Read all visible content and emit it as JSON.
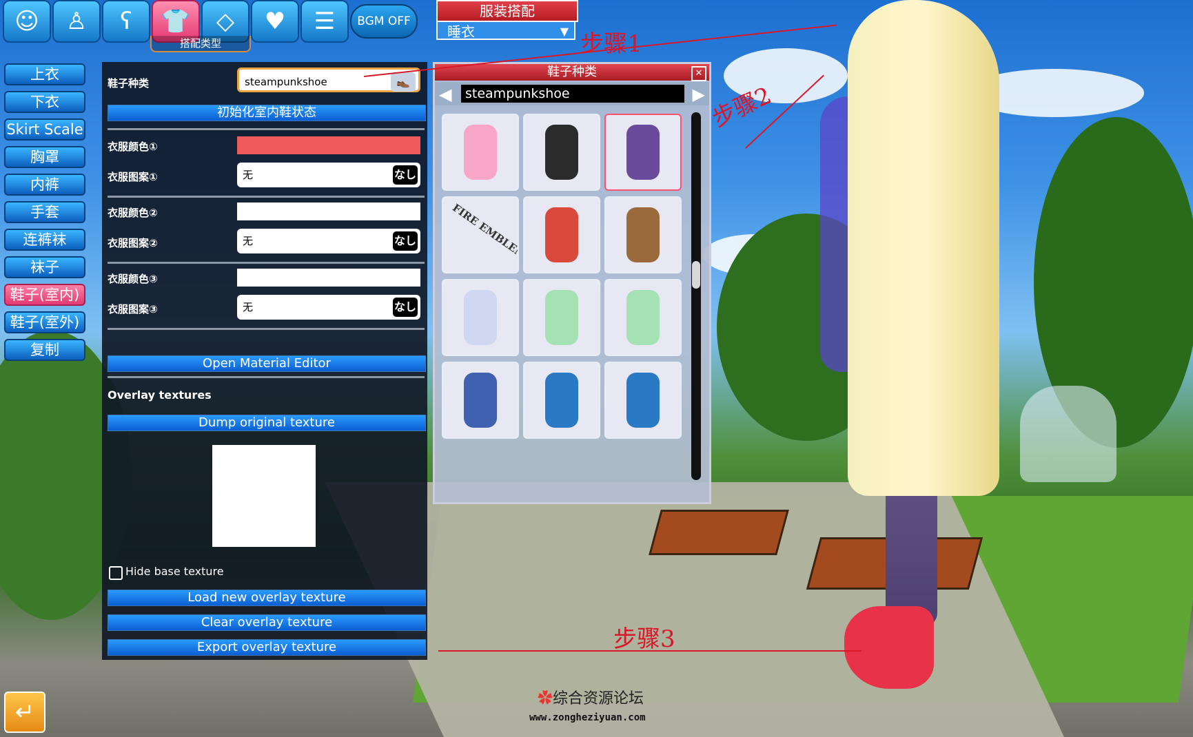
{
  "top_bar": {
    "buttons": [
      {
        "name": "face",
        "glyph": "☺"
      },
      {
        "name": "body",
        "glyph": "♙"
      },
      {
        "name": "hair",
        "glyph": "ʕ"
      },
      {
        "name": "clothing",
        "glyph": "👕"
      },
      {
        "name": "accessory",
        "glyph": "◇"
      },
      {
        "name": "h-scene",
        "glyph": "♥"
      },
      {
        "name": "document",
        "glyph": "☰"
      }
    ],
    "bgm_label": "BGM OFF",
    "category_label": "搭配类型"
  },
  "left_menu": [
    {
      "label": "上衣",
      "active": false
    },
    {
      "label": "下衣",
      "active": false
    },
    {
      "label": "Skirt Scale",
      "active": false
    },
    {
      "label": "胸罩",
      "active": false
    },
    {
      "label": "内裤",
      "active": false
    },
    {
      "label": "手套",
      "active": false
    },
    {
      "label": "连裤袜",
      "active": false
    },
    {
      "label": "袜子",
      "active": false
    },
    {
      "label": "鞋子(室内)",
      "active": true
    },
    {
      "label": "鞋子(室外)",
      "active": false
    },
    {
      "label": "复制",
      "active": false
    }
  ],
  "panel": {
    "shoe_type_label": "鞋子种类",
    "shoe_type_value": "steampunkshoe",
    "init_button": "初始化室内鞋状态",
    "color1_label": "衣服颜色①",
    "pattern1_label": "衣服图案①",
    "pattern1_value": "无",
    "color2_label": "衣服颜色②",
    "pattern2_label": "衣服图案②",
    "pattern2_value": "无",
    "color3_label": "衣服颜色③",
    "pattern3_label": "衣服图案③",
    "pattern3_value": "无",
    "nashi_label": "なし",
    "open_material_editor": "Open Material Editor",
    "overlay_textures_label": "Overlay textures",
    "dump_button": "Dump original texture",
    "hide_base_label": "Hide base texture",
    "load_button": "Load new overlay texture",
    "clear_button": "Clear overlay texture",
    "export_button": "Export overlay texture",
    "colors": {
      "color1": "#f15a5a",
      "color2": "#ffffff",
      "color3": "#ffffff"
    }
  },
  "coordinate": {
    "header": "服装搭配",
    "selected": "睡衣"
  },
  "shoe_window": {
    "title": "鞋子种类",
    "current": "steampunkshoe",
    "close_glyph": "✕",
    "items": [
      {
        "kind": "pink-stockings",
        "color": "#f7a6c8",
        "selected": false
      },
      {
        "kind": "black-boots",
        "color": "#2b2b2b",
        "selected": false
      },
      {
        "kind": "purple-heels",
        "color": "#6a4a9a",
        "selected": true
      },
      {
        "kind": "fire-emblem-card",
        "color": "#f2f2f2",
        "selected": false
      },
      {
        "kind": "red-flats",
        "color": "#d94a3a",
        "selected": false
      },
      {
        "kind": "leopard-heels",
        "color": "#9a6a3a",
        "selected": false
      },
      {
        "kind": "white-shoes",
        "color": "#cfd8f0",
        "selected": false
      },
      {
        "kind": "army-boots",
        "color": "#a4e2b4",
        "selected": false
      },
      {
        "kind": "army-boots-2",
        "color": "#a4e2b4",
        "selected": false
      },
      {
        "kind": "anime-character",
        "color": "#4060b0",
        "selected": false
      },
      {
        "kind": "black-stockings",
        "color": "#2a79c4",
        "selected": false
      },
      {
        "kind": "black-knee-boots",
        "color": "#2a79c4",
        "selected": false
      }
    ],
    "fire_emblem_text": "FIRE EMBLEM"
  },
  "annotations": {
    "step1": "步骤1",
    "step2": "步骤2",
    "step3": "步骤3"
  },
  "watermark": {
    "title": "综合资源论坛",
    "url": "www.zongheziyuan.com"
  },
  "back_glyph": "↵"
}
